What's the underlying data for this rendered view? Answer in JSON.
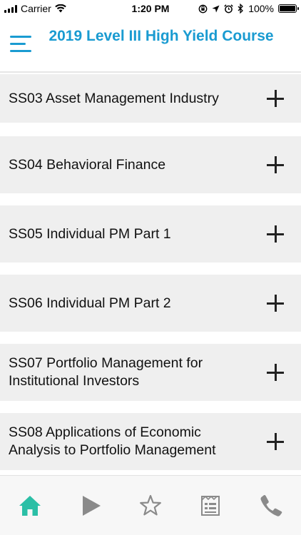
{
  "status_bar": {
    "carrier": "Carrier",
    "time": "1:20 PM",
    "battery": "100%"
  },
  "header": {
    "title": "2019 Level III High Yield Course"
  },
  "list": {
    "items": [
      {
        "label": "SS03 Asset Management Industry"
      },
      {
        "label": "SS04 Behavioral Finance"
      },
      {
        "label": "SS05 Individual PM Part 1"
      },
      {
        "label": "SS06 Individual PM Part 2"
      },
      {
        "label": "SS07 Portfolio Management for Institutional Investors"
      },
      {
        "label": "SS08 Applications of Economic Analysis to Portfolio Management"
      }
    ]
  },
  "bottom_nav": {
    "items": [
      {
        "icon": "home-icon",
        "active": true
      },
      {
        "icon": "play-icon",
        "active": false
      },
      {
        "icon": "star-icon",
        "active": false
      },
      {
        "icon": "notes-icon",
        "active": false
      },
      {
        "icon": "phone-icon",
        "active": false
      }
    ]
  },
  "colors": {
    "accent": "#1a9bd1",
    "active_nav": "#2bbfa6",
    "inactive_nav": "#8a8a8a",
    "item_bg": "#efefef"
  }
}
